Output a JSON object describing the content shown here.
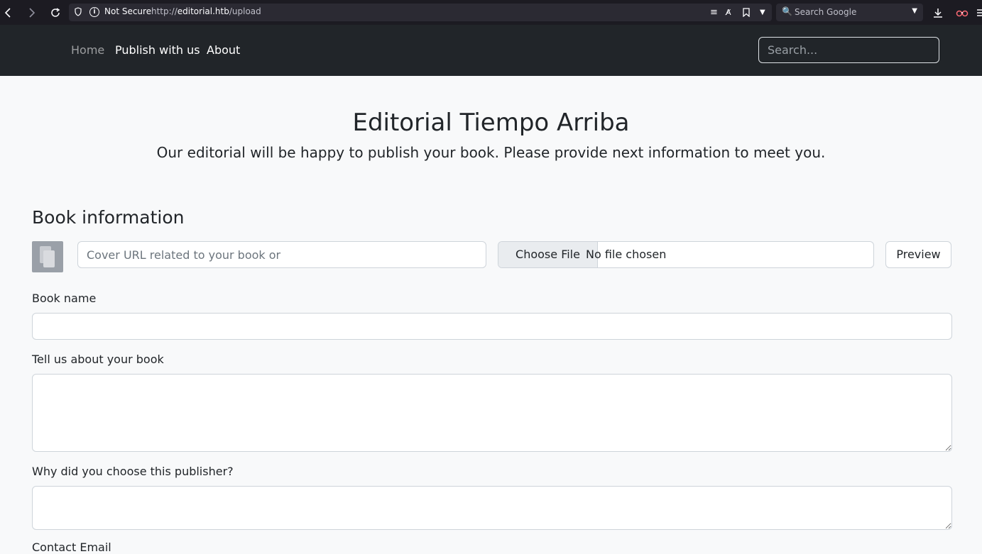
{
  "browser": {
    "not_secure": "Not Secure",
    "url_prefix": "http://",
    "url_host": "editorial.htb",
    "url_path": "/upload",
    "search_placeholder": "Search Google"
  },
  "nav": {
    "home": "Home",
    "publish": "Publish with us",
    "about": "About",
    "search_placeholder": "Search..."
  },
  "hero": {
    "title": "Editorial Tiempo Arriba",
    "subtitle": "Our editorial will be happy to publish your book. Please provide next information to meet you."
  },
  "form": {
    "section_title": "Book information",
    "cover_url_placeholder": "Cover URL related to your book or",
    "choose_file": "Choose File",
    "no_file": "No file chosen",
    "preview": "Preview",
    "book_name_label": "Book name",
    "about_label": "Tell us about your book",
    "why_label": "Why did you choose this publisher?",
    "email_label": "Contact Email"
  }
}
